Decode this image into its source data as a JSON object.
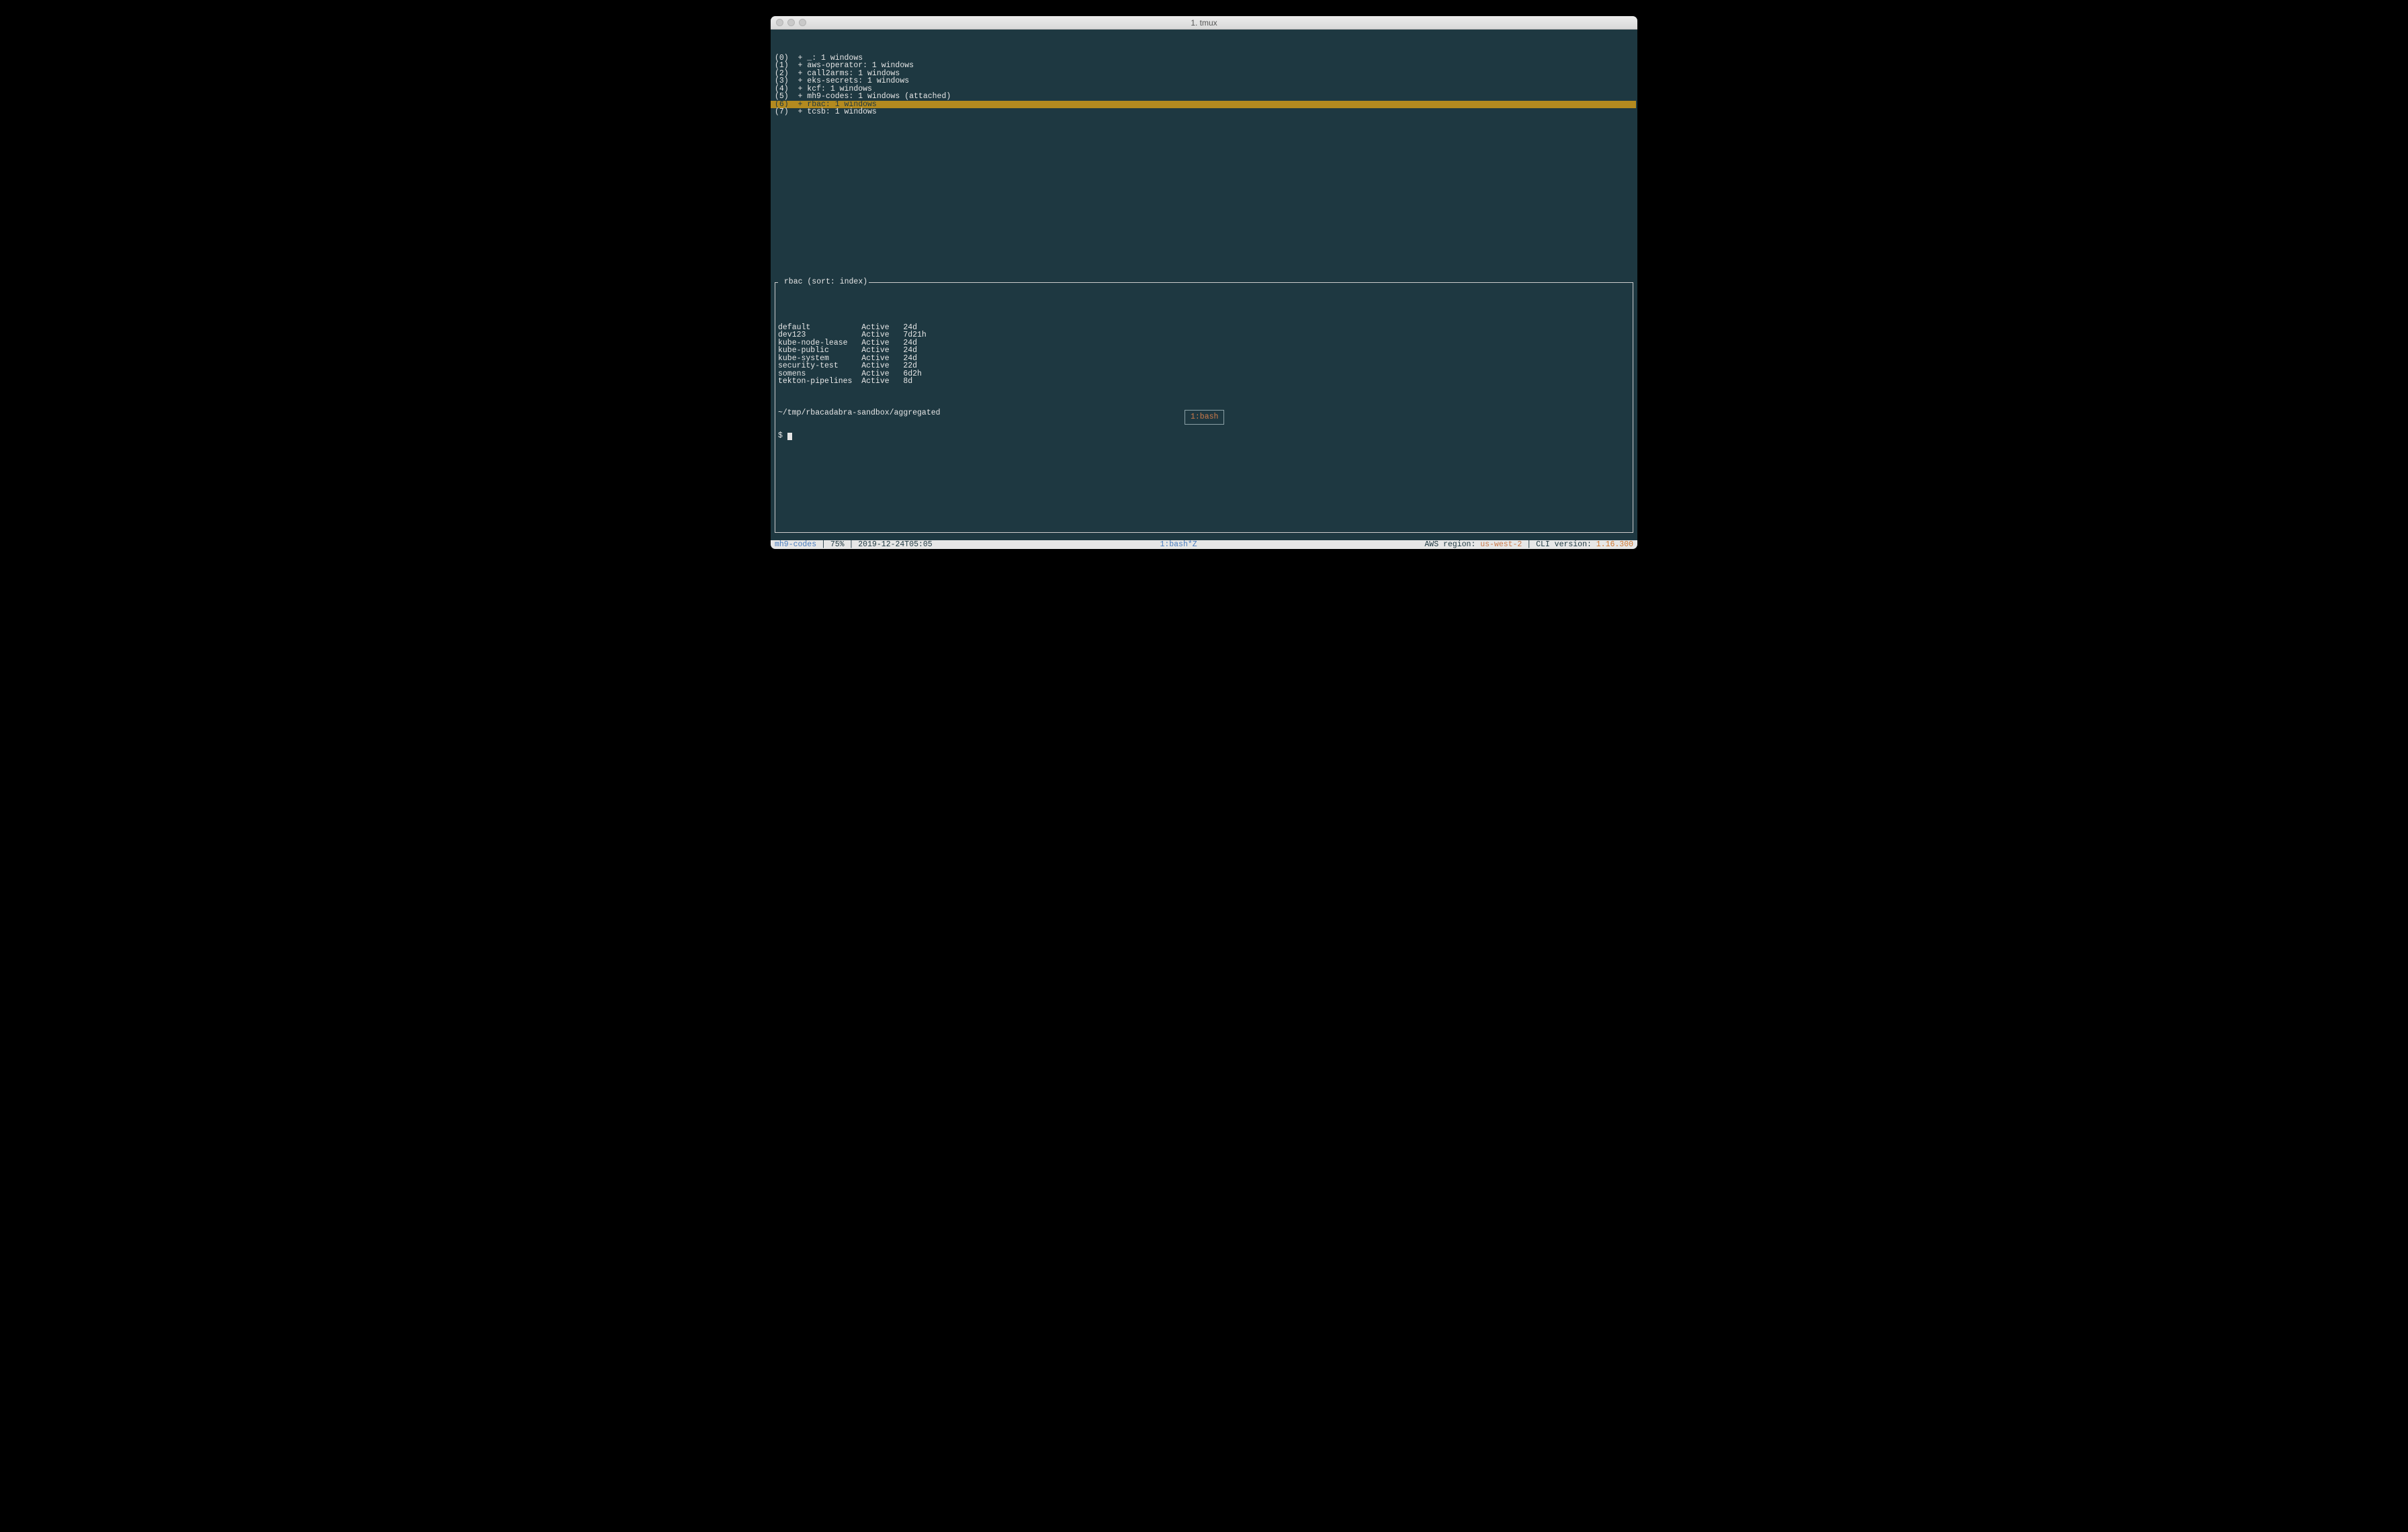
{
  "window": {
    "title": "1. tmux"
  },
  "sessions": {
    "items": [
      {
        "text": "(0)  + _: 1 windows",
        "selected": false
      },
      {
        "text": "(1)  + aws-operator: 1 windows",
        "selected": false
      },
      {
        "text": "(2)  + call2arms: 1 windows",
        "selected": false
      },
      {
        "text": "(3)  + eks-secrets: 1 windows",
        "selected": false
      },
      {
        "text": "(4)  + kcf: 1 windows",
        "selected": false
      },
      {
        "text": "(5)  + mh9-codes: 1 windows (attached)",
        "selected": false
      },
      {
        "text": "(6)  + rbac: 1 windows",
        "selected": true
      },
      {
        "text": "(7)  + tcsb: 1 windows",
        "selected": false
      }
    ]
  },
  "preview": {
    "title": " rbac (sort: index)",
    "rows": [
      {
        "name": "default",
        "status": "Active",
        "age": "24d"
      },
      {
        "name": "dev123",
        "status": "Active",
        "age": "7d21h"
      },
      {
        "name": "kube-node-lease",
        "status": "Active",
        "age": "24d"
      },
      {
        "name": "kube-public",
        "status": "Active",
        "age": "24d"
      },
      {
        "name": "kube-system",
        "status": "Active",
        "age": "24d"
      },
      {
        "name": "security-test",
        "status": "Active",
        "age": "22d"
      },
      {
        "name": "somens",
        "status": "Active",
        "age": "6d2h"
      },
      {
        "name": "tekton-pipelines",
        "status": "Active",
        "age": "8d"
      }
    ],
    "cwd": "~/tmp/rbacadabra-sandbox/aggregated",
    "prompt": "$ "
  },
  "float": {
    "label": "1:bash"
  },
  "status": {
    "left": {
      "session": "mh9-codes",
      "battery": "75%",
      "datetime": "2019-12-24T05:05"
    },
    "center": "1:bash*Z",
    "right": {
      "region_label": "AWS region: ",
      "region_value": "us-west-2",
      "cli_label": "CLI version: ",
      "cli_value": "1.16.300"
    }
  }
}
